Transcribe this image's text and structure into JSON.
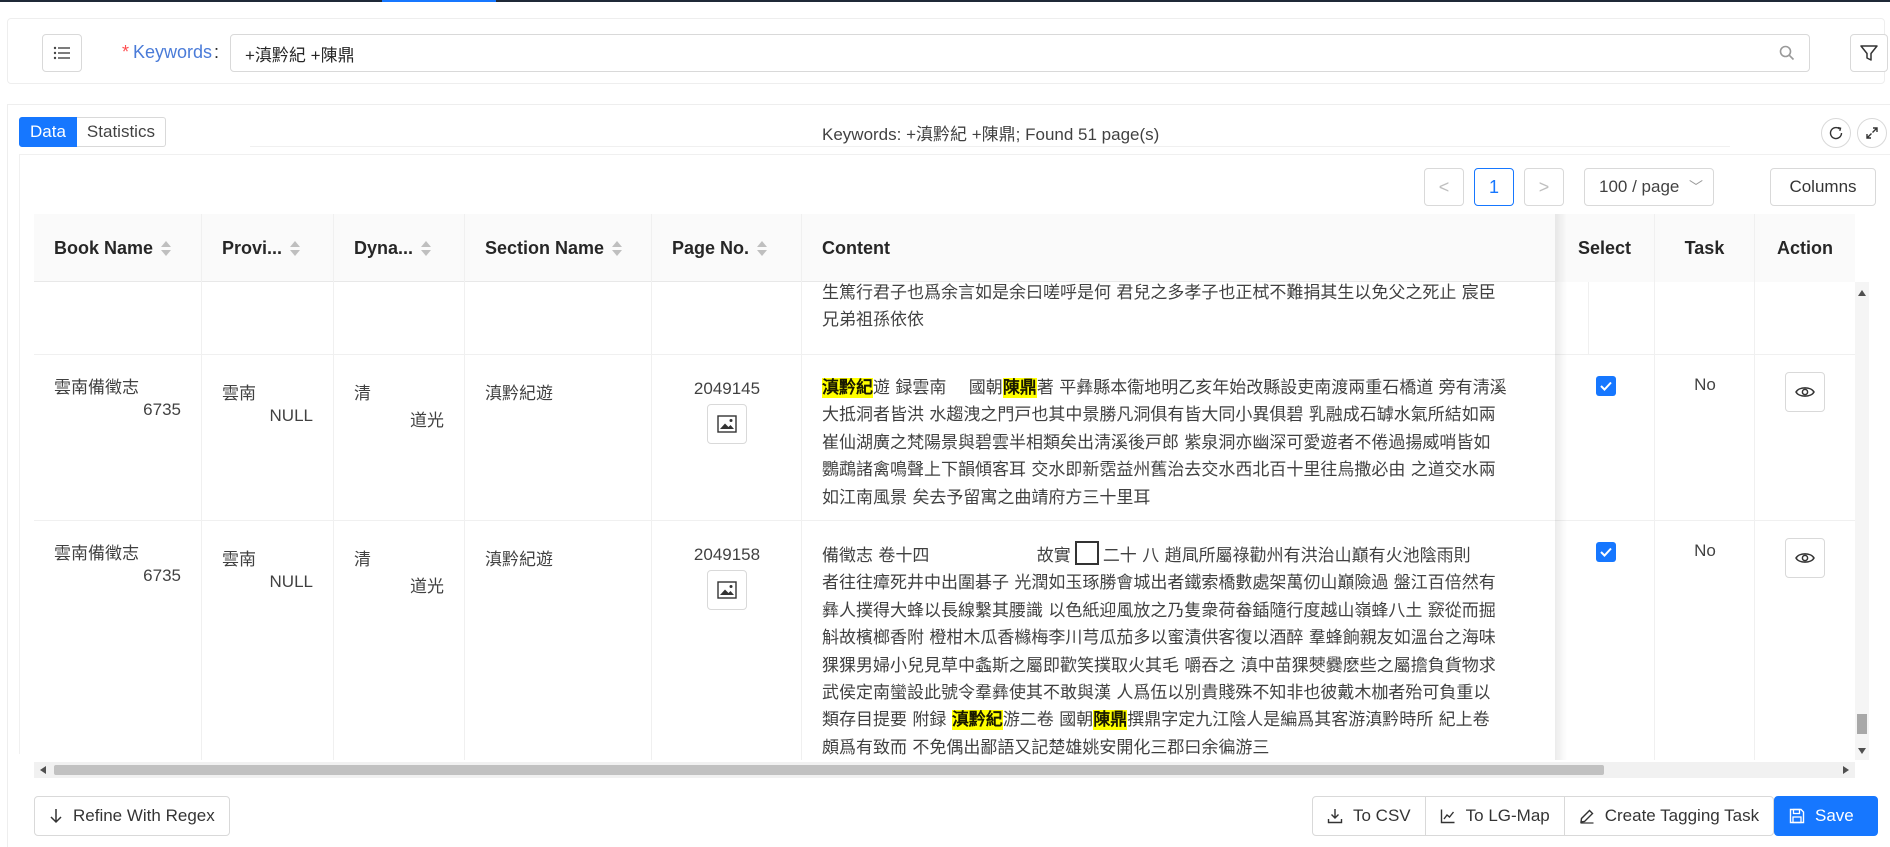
{
  "search": {
    "required_mark": "*",
    "label": "Keywords",
    "colon": ":",
    "value": "+滇黔紀 +陳鼎"
  },
  "tabs": [
    {
      "label": "Data",
      "active": true
    },
    {
      "label": "Statistics",
      "active": false
    }
  ],
  "summary": "Keywords: +滇黔紀 +陳鼎; Found 51 page(s)",
  "pagination": {
    "prev": "<",
    "current": "1",
    "next": ">",
    "page_size": "100 / page",
    "columns_label": "Columns"
  },
  "table": {
    "columns": [
      "Book Name",
      "Provi...",
      "Dyna...",
      "Section Name",
      "Page No.",
      "Content",
      "Select",
      "Task",
      "Action"
    ],
    "top_partial_row": {
      "content_lines": [
        "生篤行君子也爲余言如是余曰嗟呼是何 君兒之多孝子也正栻不難捐其生以免父之死止 宸臣",
        "兄弟祖孫依依"
      ]
    },
    "rows": [
      {
        "book_name": "雲南備徵志",
        "book_id": "6735",
        "province": "雲南",
        "province_sub": "NULL",
        "dynasty": "清",
        "reign": "道光",
        "section": "滇黔紀遊",
        "page_no": "2049145",
        "content_lines": [
          [
            {
              "t": "滇黔紀",
              "hl": true
            },
            {
              "t": "遊 録雲南　 國朝",
              "hl": false
            },
            {
              "t": "陳鼎",
              "hl": true
            },
            {
              "t": "著 平彝縣本衞地明乙亥年始改縣設吏南渡兩重石橋道 旁有淸溪",
              "hl": false
            }
          ],
          [
            {
              "t": "大抵洞者皆洪 水趨洩之門戸也其中景勝凡洞俱有皆大同小異俱碧 乳融成石罅水氣所結如兩",
              "hl": false
            }
          ],
          [
            {
              "t": "崔仙湖廣之梵陽景與碧雲半相類矣出淸溪後戸郎 紫泉洞亦幽深可愛遊者不倦過揚威哨皆如",
              "hl": false
            }
          ],
          [
            {
              "t": "鸚鵡諸禽鳴聲上下韻傾客耳 交水即新霑益州舊治去交水西北百十里往烏撒必由 之道交水兩",
              "hl": false
            }
          ],
          [
            {
              "t": "如江南風景 矣去予留寓之曲靖府方三十里耳",
              "hl": false
            }
          ]
        ],
        "selected": true,
        "task": "No"
      },
      {
        "book_name": "雲南備徵志",
        "book_id": "6735",
        "province": "雲南",
        "province_sub": "NULL",
        "dynasty": "清",
        "reign": "道光",
        "section": "滇黔紀遊",
        "page_no": "2049158",
        "content_lines": [
          [
            {
              "t": "備徵志 卷十四　　　　　　 故實",
              "hl": false
            },
            {
              "t": "[box]",
              "hl": false
            },
            {
              "t": "二十 八 趙凬所屬祿勸州有洪治山巔有火池陰雨則",
              "hl": false
            }
          ],
          [
            {
              "t": "者往往瘴死井中出圍碁子 光潤如玉琢勝會城出者鐵索橋數處架萬仞山巔險過 盤江百倍然有",
              "hl": false
            }
          ],
          [
            {
              "t": "彝人撲得大蜂以長線繫其腰識 以色紙迎風放之乃隻衆荷畚鍤隨行度越山嶺蜂八土 窾從而掘",
              "hl": false
            }
          ],
          [
            {
              "t": "斛故檳榔香附 橙柑木瓜香櫞梅李川芎瓜茄多以蜜漬供客復以酒醉 羣蜂餉親友如溫台之海味",
              "hl": false
            }
          ],
          [
            {
              "t": "猓猓男婦小兒見草中螽斯之屬即歡笑撲取火其毛 嚼吞之 滇中苗猓僰爨麽些之屬擔負貨物求",
              "hl": false
            }
          ],
          [
            {
              "t": "武侯定南蠻設此號令羣彝使其不敢與漢 人爲伍以別貴賤殊不知非也彼戴木枷者殆可負重以",
              "hl": false
            }
          ],
          [
            {
              "t": "類存目提要 附録 ",
              "hl": false
            },
            {
              "t": "滇黔紀",
              "hl": true
            },
            {
              "t": "游二卷 國朝",
              "hl": false
            },
            {
              "t": "陳鼎",
              "hl": true
            },
            {
              "t": "撰鼎字定九江陰人是編爲其客游滇黔時所 紀上卷",
              "hl": false
            }
          ],
          [
            {
              "t": "頗爲有致而 不免偶出鄙語又記楚雄姚安開化三郡曰余徧游三",
              "hl": false
            }
          ]
        ],
        "selected": true,
        "task": "No"
      }
    ]
  },
  "footer": {
    "refine_label": "Refine With Regex",
    "csv_label": "To CSV",
    "lgmap_label": "To LG-Map",
    "tagging_label": "Create Tagging Task",
    "save_label": "Save"
  },
  "colors": {
    "primary": "#1677ff",
    "highlight": "#ffff00",
    "required": "#ff4d4f",
    "label_blue": "#4a7bd8"
  }
}
